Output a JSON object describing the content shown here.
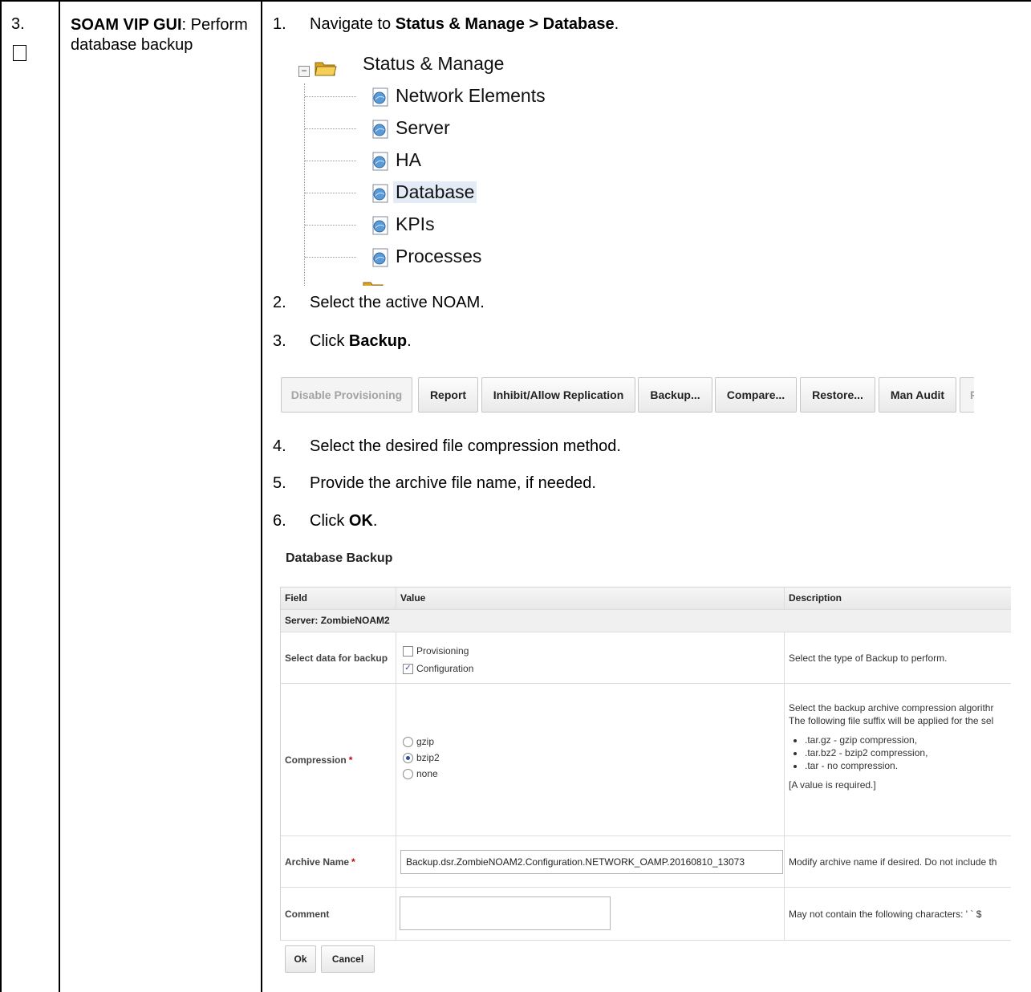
{
  "step": {
    "number": "3.",
    "title_bold": "SOAM VIP GUI",
    "title_rest": ": Perform database backup"
  },
  "instructions": [
    {
      "num": "1.",
      "pre": "Navigate to ",
      "bold": "Status & Manage > Database",
      "post": "."
    },
    {
      "num": "2.",
      "pre": "Select the active NOAM.",
      "bold": "",
      "post": ""
    },
    {
      "num": "3.",
      "pre": "Click ",
      "bold": "Backup",
      "post": "."
    },
    {
      "num": "4.",
      "pre": "Select the desired file compression method.",
      "bold": "",
      "post": ""
    },
    {
      "num": "5.",
      "pre": "Provide the archive file name, if needed.",
      "bold": "",
      "post": ""
    },
    {
      "num": "6.",
      "pre": "Click ",
      "bold": "OK",
      "post": "."
    }
  ],
  "tree": {
    "root": "Status & Manage",
    "items": [
      "Network Elements",
      "Server",
      "HA",
      "Database",
      "KPIs",
      "Processes"
    ],
    "selected": "Database",
    "icons": {
      "root": "folder-open-icon",
      "item": "status-page-icon"
    }
  },
  "toolbar": {
    "buttons": [
      "Disable Provisioning",
      "Report",
      "Inhibit/Allow Replication",
      "Backup...",
      "Compare...",
      "Restore...",
      "Man Audit",
      "Resu"
    ],
    "disabled": [
      "Disable Provisioning",
      "Resu"
    ]
  },
  "form": {
    "title": "Database Backup",
    "headers": {
      "field": "Field",
      "value": "Value",
      "description": "Description"
    },
    "server_row": "Server: ZombieNOAM2",
    "select_data": {
      "label": "Select data for backup",
      "options": [
        {
          "label": "Provisioning",
          "checked": false
        },
        {
          "label": "Configuration",
          "checked": true
        }
      ],
      "description": "Select the type of Backup to perform."
    },
    "compression": {
      "label": "Compression",
      "required_mark": "*",
      "options": [
        {
          "label": "gzip",
          "selected": false
        },
        {
          "label": "bzip2",
          "selected": true
        },
        {
          "label": "none",
          "selected": false
        }
      ],
      "desc_line1": "Select the backup archive compression algorithr",
      "desc_line2": "The following file suffix will be applied for the sel",
      "desc_items": [
        ".tar.gz - gzip compression,",
        ".tar.bz2 - bzip2 compression,",
        ".tar - no compression."
      ],
      "desc_required": "[A value is required.]"
    },
    "archive": {
      "label": "Archive Name",
      "required_mark": "*",
      "value": "Backup.dsr.ZombieNOAM2.Configuration.NETWORK_OAMP.20160810_13073",
      "description": "Modify archive name if desired. Do not include th"
    },
    "comment": {
      "label": "Comment",
      "value": "",
      "description": "May not contain the following characters: ' ` $"
    },
    "buttons": {
      "ok": "Ok",
      "cancel": "Cancel"
    }
  },
  "colors": {
    "tree_selected_bg": "#e3ebf7",
    "required": "#cc0000",
    "check_accent": "#2a4f9e"
  }
}
